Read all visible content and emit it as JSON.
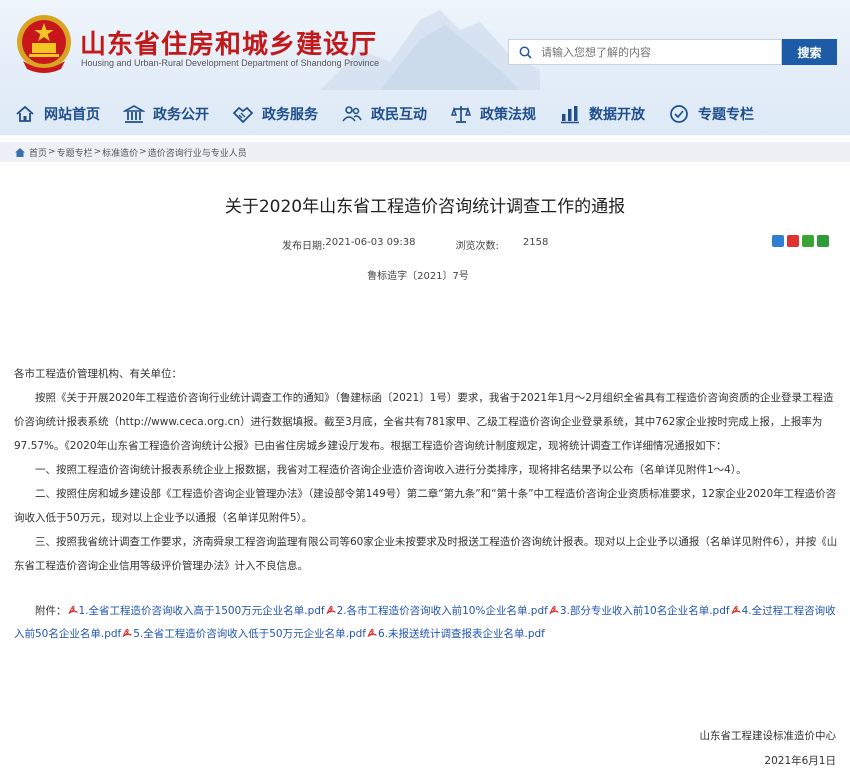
{
  "header": {
    "title": "山东省住房和城乡建设厅",
    "subtitle": "Housing and Urban-Rural Development Department of Shandong Province",
    "search_placeholder": "请输入您想了解的内容",
    "search_button": "搜索"
  },
  "nav": {
    "items": [
      {
        "label": "网站首页",
        "icon": "home-icon"
      },
      {
        "label": "政务公开",
        "icon": "government-building-icon"
      },
      {
        "label": "政务服务",
        "icon": "handshake-icon"
      },
      {
        "label": "政民互动",
        "icon": "people-icon"
      },
      {
        "label": "政策法规",
        "icon": "scale-icon"
      },
      {
        "label": "数据开放",
        "icon": "bar-chart-icon"
      },
      {
        "label": "专题专栏",
        "icon": "column-icon"
      }
    ]
  },
  "breadcrumb": {
    "items": [
      "首页",
      "专题专栏",
      "标准造价",
      "造价咨询行业与专业人员"
    ],
    "separator": ">"
  },
  "article": {
    "title": "关于2020年山东省工程造价咨询统计调查工作的通报",
    "publish_label": "发布日期:",
    "publish_date": "2021-06-03 09:38",
    "views_label": "浏览次数:",
    "views": "2158",
    "doc_no": "鲁标造字〔2021〕7号",
    "salutation": "各市工程造价管理机构、有关单位：",
    "p1_a": "按照《关于开展2020年工程造价咨询行业统计调查工作的通知》（鲁建标函〔2021〕1号）要求，我省于2021年1月～2月组织全省具有工程造价咨询资质的企业登录工程造价咨询统计报表系统（",
    "p1_link": "http://www.ceca.org.cn",
    "p1_b": "）进行数据填报。截至3月底，全省共有781家甲、乙级工程造价咨询企业登录系统，其中762家企业按时完成上报，上报率为97.57%。《2020年山东省工程造价咨询统计公报》已由省住房城乡建设厅发布。根据工程造价咨询统计制度规定，现将统计调查工作详细情况通报如下：",
    "p2": "一、按照工程造价咨询统计报表系统企业上报数据，我省对工程造价咨询企业造价咨询收入进行分类排序，现将排名结果予以公布（名单详见附件1～4）。",
    "p3": "二、按照住房和城乡建设部《工程造价咨询企业管理办法》（建设部令第149号）第二章“第九条”和“第十条”中工程造价咨询企业资质标准要求，12家企业2020年工程造价咨询收入低于50万元，现对以上企业予以通报（名单详见附件5）。",
    "p4": "三、按照我省统计调查工作要求，济南舜泉工程咨询监理有限公司等60家企业未按要求及时报送工程造价咨询统计报表。现对以上企业予以通报（名单详见附件6），并按《山东省工程造价咨询企业信用等级评价管理办法》计入不良信息。",
    "attach_label": "附件：",
    "attachments": [
      "1.全省工程造价咨询收入高于1500万元企业名单.pdf",
      "2.各市工程造价咨询收入前10%企业名单.pdf",
      "3.部分专业收入前10名企业名单.pdf",
      "4.全过程工程咨询收入前50名企业名单.pdf",
      "5.全省工程造价咨询收入低于50万元企业名单.pdf",
      "6.未报送统计调查报表企业名单.pdf"
    ],
    "signer": "山东省工程建设标准造价中心",
    "sign_date": "2021年6月1日"
  },
  "colors": {
    "title_red": "#c01a1a",
    "nav_blue": "#1e4e8c",
    "search_button": "#1e5ba6",
    "link_blue": "#2255b0"
  }
}
